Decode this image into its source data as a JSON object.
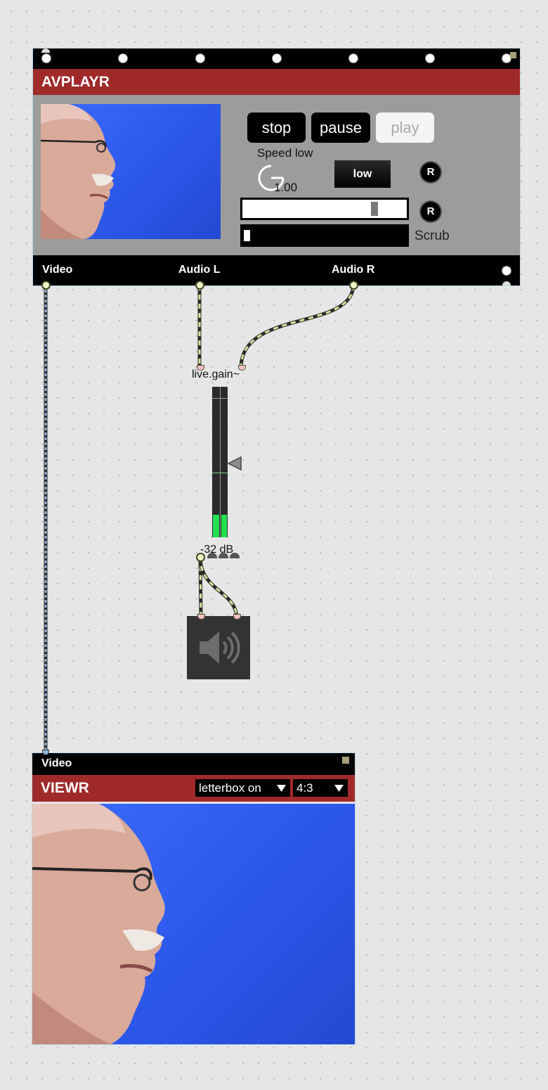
{
  "avplayr": {
    "title": "AVPLAYR",
    "buttons": {
      "stop": "stop",
      "pause": "pause",
      "play": "play"
    },
    "speed_label": "Speed low",
    "speed_value": "1.00",
    "low_button": "low",
    "reset_label": "R",
    "scrub_label": "Scrub",
    "outlets": {
      "video": "Video",
      "audio_l": "Audio L",
      "audio_r": "Audio R"
    }
  },
  "gain": {
    "object_label": "live.gain~",
    "value": "-32 dB"
  },
  "viewr": {
    "inlet_label": "Video",
    "title": "VIEWR",
    "letterbox": "letterbox on",
    "aspect": "4:3"
  },
  "colors": {
    "title_bar": "#a02a2a",
    "canvas": "#e6e6e6",
    "video_blue": "#2c58ea",
    "meter_green": "#22e04e",
    "audio_cable": "#d4e59a",
    "video_cable": "#8fb3d8"
  },
  "icons": [
    "speaker-icon",
    "dropdown-arrow-icon",
    "dial-icon"
  ]
}
